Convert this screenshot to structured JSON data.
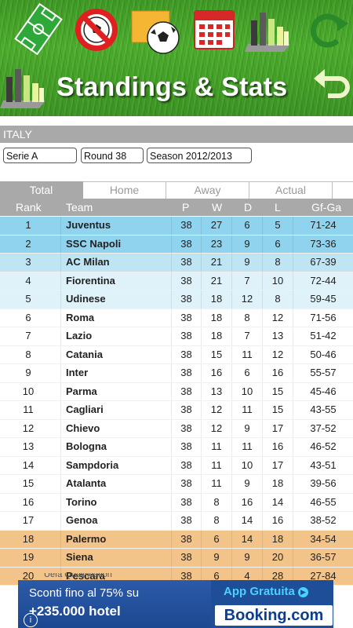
{
  "title": "Standings & Stats",
  "toolbar": {
    "icons": [
      "soccer-field-icon",
      "no-ball-icon",
      "ball-on-sticky-note-icon",
      "calendar-icon",
      "bar-chart-icon",
      "refresh-icon"
    ]
  },
  "country": "ITALY",
  "filters": {
    "league": "Serie A",
    "round": "Round 38",
    "season": "Season 2012/2013"
  },
  "tabs": [
    "Total",
    "Home",
    "Away",
    "Actual"
  ],
  "columns": {
    "rank": "Rank",
    "team": "Team",
    "p": "P",
    "w": "W",
    "d": "D",
    "l": "L",
    "g": "Gf-Ga"
  },
  "rows": [
    {
      "rank": "1",
      "team": "Juventus",
      "p": "38",
      "w": "27",
      "d": "6",
      "l": "5",
      "g": "71-24",
      "zone": "cl"
    },
    {
      "rank": "2",
      "team": "SSC Napoli",
      "p": "38",
      "w": "23",
      "d": "9",
      "l": "6",
      "g": "73-36",
      "zone": "cl"
    },
    {
      "rank": "3",
      "team": "AC Milan",
      "p": "38",
      "w": "21",
      "d": "9",
      "l": "8",
      "g": "67-39",
      "zone": "clq"
    },
    {
      "rank": "4",
      "team": "Fiorentina",
      "p": "38",
      "w": "21",
      "d": "7",
      "l": "10",
      "g": "72-44",
      "zone": "el"
    },
    {
      "rank": "5",
      "team": "Udinese",
      "p": "38",
      "w": "18",
      "d": "12",
      "l": "8",
      "g": "59-45",
      "zone": "el"
    },
    {
      "rank": "6",
      "team": "Roma",
      "p": "38",
      "w": "18",
      "d": "8",
      "l": "12",
      "g": "71-56",
      "zone": ""
    },
    {
      "rank": "7",
      "team": "Lazio",
      "p": "38",
      "w": "18",
      "d": "7",
      "l": "13",
      "g": "51-42",
      "zone": ""
    },
    {
      "rank": "8",
      "team": "Catania",
      "p": "38",
      "w": "15",
      "d": "11",
      "l": "12",
      "g": "50-46",
      "zone": ""
    },
    {
      "rank": "9",
      "team": "Inter",
      "p": "38",
      "w": "16",
      "d": "6",
      "l": "16",
      "g": "55-57",
      "zone": ""
    },
    {
      "rank": "10",
      "team": "Parma",
      "p": "38",
      "w": "13",
      "d": "10",
      "l": "15",
      "g": "45-46",
      "zone": ""
    },
    {
      "rank": "11",
      "team": "Cagliari",
      "p": "38",
      "w": "12",
      "d": "11",
      "l": "15",
      "g": "43-55",
      "zone": ""
    },
    {
      "rank": "12",
      "team": "Chievo",
      "p": "38",
      "w": "12",
      "d": "9",
      "l": "17",
      "g": "37-52",
      "zone": ""
    },
    {
      "rank": "13",
      "team": "Bologna",
      "p": "38",
      "w": "11",
      "d": "11",
      "l": "16",
      "g": "46-52",
      "zone": ""
    },
    {
      "rank": "14",
      "team": "Sampdoria",
      "p": "38",
      "w": "11",
      "d": "10",
      "l": "17",
      "g": "43-51",
      "zone": ""
    },
    {
      "rank": "15",
      "team": "Atalanta",
      "p": "38",
      "w": "11",
      "d": "9",
      "l": "18",
      "g": "39-56",
      "zone": ""
    },
    {
      "rank": "16",
      "team": "Torino",
      "p": "38",
      "w": "8",
      "d": "16",
      "l": "14",
      "g": "46-55",
      "zone": ""
    },
    {
      "rank": "17",
      "team": "Genoa",
      "p": "38",
      "w": "8",
      "d": "14",
      "l": "16",
      "g": "38-52",
      "zone": ""
    },
    {
      "rank": "18",
      "team": "Palermo",
      "p": "38",
      "w": "6",
      "d": "14",
      "l": "18",
      "g": "34-54",
      "zone": "rel"
    },
    {
      "rank": "19",
      "team": "Siena",
      "p": "38",
      "w": "9",
      "d": "9",
      "l": "20",
      "g": "36-57",
      "zone": "rel"
    },
    {
      "rank": "20",
      "team": "Pescara",
      "p": "38",
      "w": "6",
      "d": "4",
      "l": "28",
      "g": "27-84",
      "zone": "rel"
    }
  ],
  "zone_colors": {
    "cl": "#8fd3ee",
    "clq": "#bfe5f4",
    "el": "#dff2fa",
    "rel": "#f3c48a",
    "": "#ffffff"
  },
  "legend_partial": "Uefa Qualification",
  "ad": {
    "line1": "Sconti fino al 75% su",
    "line2": "+235.000 hotel",
    "app": "App Gratuita",
    "brand": "Booking.com",
    "info": "i"
  }
}
